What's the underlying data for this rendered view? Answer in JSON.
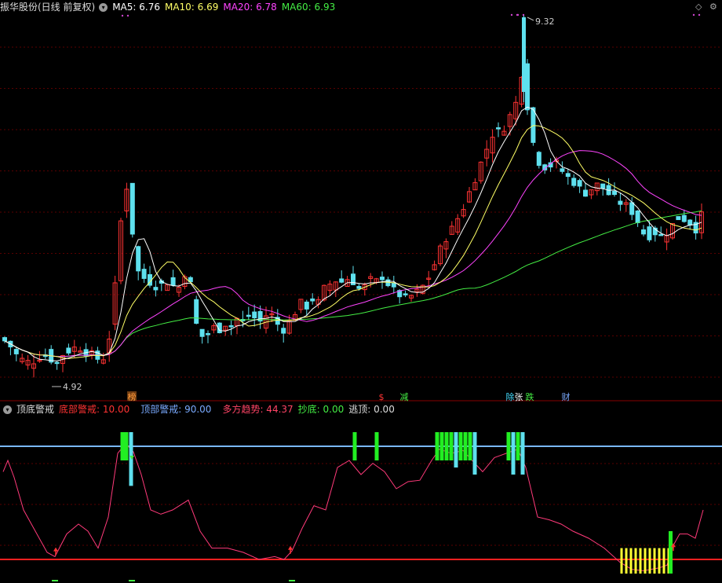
{
  "main": {
    "title": "振华股份(日线 前复权)",
    "ma": [
      {
        "label": "MA5: 6.76",
        "color": "#ffffff"
      },
      {
        "label": "MA10: 6.69",
        "color": "#ffff66"
      },
      {
        "label": "MA20: 6.78",
        "color": "#ff44ff"
      },
      {
        "label": "MA60: 6.93",
        "color": "#44ee44"
      }
    ],
    "high_label": "9.32",
    "low_label": "4.92",
    "events": [
      {
        "text": "榜",
        "color": "#ff9a3c",
        "bg": "#6b3a10"
      },
      {
        "text": "$",
        "color": "#ff3333",
        "bg": ""
      },
      {
        "text": "减",
        "color": "#44ee44",
        "bg": ""
      },
      {
        "text": "除",
        "color": "#44ddff",
        "bg": ""
      },
      {
        "text": "张",
        "color": "#ffffff",
        "bg": ""
      },
      {
        "text": "跌",
        "color": "#44ee44",
        "bg": ""
      },
      {
        "text": "财",
        "color": "#7aaaff",
        "bg": ""
      }
    ]
  },
  "indicator": {
    "name": "顶底警戒",
    "items": [
      {
        "label": "底部警戒: 10.00",
        "color": "#ff3333"
      },
      {
        "label": "顶部警戒: 90.00",
        "color": "#7aaaff"
      },
      {
        "label": "多方趋势: 44.37",
        "color": "#ff4466"
      },
      {
        "label": "抄底: 0.00",
        "color": "#44ee44"
      },
      {
        "label": "逃顶: 0.00",
        "color": "#dddddd"
      }
    ]
  },
  "colors": {
    "up": "#ff3333",
    "down": "#5ee0ee",
    "ma5": "#ffffff",
    "ma10": "#ffff66",
    "ma20": "#ff44ff",
    "ma60": "#44ee44",
    "bull": "#ff3a7a",
    "escape": "#5ee0ee",
    "buy": "#22ee22",
    "bottom": "#ffff33"
  },
  "icons": {
    "menu": "circle-menu-icon",
    "diamond": "diamond-icon",
    "gear": "gear-icon"
  }
}
